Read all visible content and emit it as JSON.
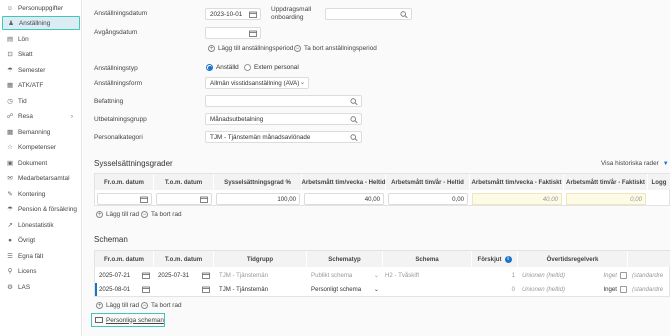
{
  "sidebar": {
    "items": [
      {
        "label": "Personuppgifter",
        "icon": "person-icon"
      },
      {
        "label": "Anställning",
        "icon": "person-badge-icon"
      },
      {
        "label": "Lön",
        "icon": "money-icon"
      },
      {
        "label": "Skatt",
        "icon": "tax-icon"
      },
      {
        "label": "Semester",
        "icon": "umbrella-icon"
      },
      {
        "label": "ATK/ATF",
        "icon": "calendar-icon"
      },
      {
        "label": "Tid",
        "icon": "clock-icon"
      },
      {
        "label": "Resa",
        "icon": "globe-icon"
      },
      {
        "label": "Bemanning",
        "icon": "staffing-icon"
      },
      {
        "label": "Kompetenser",
        "icon": "badge-icon"
      },
      {
        "label": "Dokument",
        "icon": "document-icon"
      },
      {
        "label": "Medarbetarsamtal",
        "icon": "chat-icon"
      },
      {
        "label": "Kontering",
        "icon": "accounting-icon"
      },
      {
        "label": "Pension & försäkring",
        "icon": "umbrella-icon"
      },
      {
        "label": "Lönestatistik",
        "icon": "statistics-icon"
      },
      {
        "label": "Övrigt",
        "icon": "misc-icon"
      },
      {
        "label": "Egna fält",
        "icon": "fields-icon"
      },
      {
        "label": "Licens",
        "icon": "key-icon"
      },
      {
        "label": "LAS",
        "icon": "las-icon"
      }
    ],
    "active_index": 1
  },
  "employment": {
    "start_label": "Anställningsdatum",
    "start_value": "2023-10-01",
    "onboarding_label": "Uppdragsmall onboarding",
    "onboarding_value": "",
    "end_label": "Avgångsdatum",
    "end_value": "",
    "add_period": "Lägg till anställningsperiod",
    "remove_period": "Ta bort anställningsperiod",
    "type_label": "Anställningstyp",
    "type_options": [
      "Anställd",
      "Extern personal"
    ],
    "type_selected": "Anställd",
    "form_label": "Anställningsform",
    "form_value": "Allmän visstidsanställning (AVA)",
    "position_label": "Befattning",
    "position_value": "",
    "payment_label": "Utbetalningsgrupp",
    "payment_value": "Månadsutbetalning",
    "category_label": "Personalkategori",
    "category_value": "TJM - Tjänstemän månadsavlönade"
  },
  "occupancy": {
    "title": "Sysselsättningsgrader",
    "history_link": "Visa historiska rader",
    "columns": [
      "Fr.o.m. datum",
      "T.o.m. datum",
      "Sysselsättningsgrad %",
      "Arbetsmått tim/vecka - Heltid",
      "Arbetsmått tim/år - Heltid",
      "Arbetsmått tim/vecka - Faktiskt",
      "Arbetsmått tim/år - Faktiskt",
      "Logg"
    ],
    "rows": [
      {
        "from": "",
        "to": "",
        "degree": "100,00",
        "week_full": "40,00",
        "year_full": "0,00",
        "week_actual": "40,00",
        "year_actual": "0,00"
      }
    ],
    "add_row": "Lägg till rad",
    "remove_row": "Ta bort rad"
  },
  "schedules": {
    "title": "Scheman",
    "columns": [
      "Fr.o.m. datum",
      "T.o.m. datum",
      "Tidgrupp",
      "Schematyp",
      "Schema",
      "Förskjut",
      "Övertidsregelverk"
    ],
    "rows": [
      {
        "from": "2025-07-21",
        "to": "2025-07-31",
        "group": "TJM - Tjänstemän",
        "type": "Publikt schema",
        "schema": "H2 - Tvåskift",
        "shift": "1",
        "overtime": "Unionen (heltid)",
        "none": "Inget",
        "extra": "(standardre"
      },
      {
        "from": "2025-08-01",
        "to": "",
        "group": "TJM - Tjänstemän",
        "type": "Personligt schema",
        "schema": "",
        "shift": "0",
        "overtime": "Unionen (heltid)",
        "none": "Inget",
        "extra": "(standardre"
      }
    ],
    "add_row": "Lägg till rad",
    "remove_row": "Ta bort rad",
    "personal_link": "Personliga scheman"
  },
  "colors": {
    "accent": "#3ec9b6",
    "link": "#1a73c9",
    "active_bg": "#dcecf5"
  }
}
